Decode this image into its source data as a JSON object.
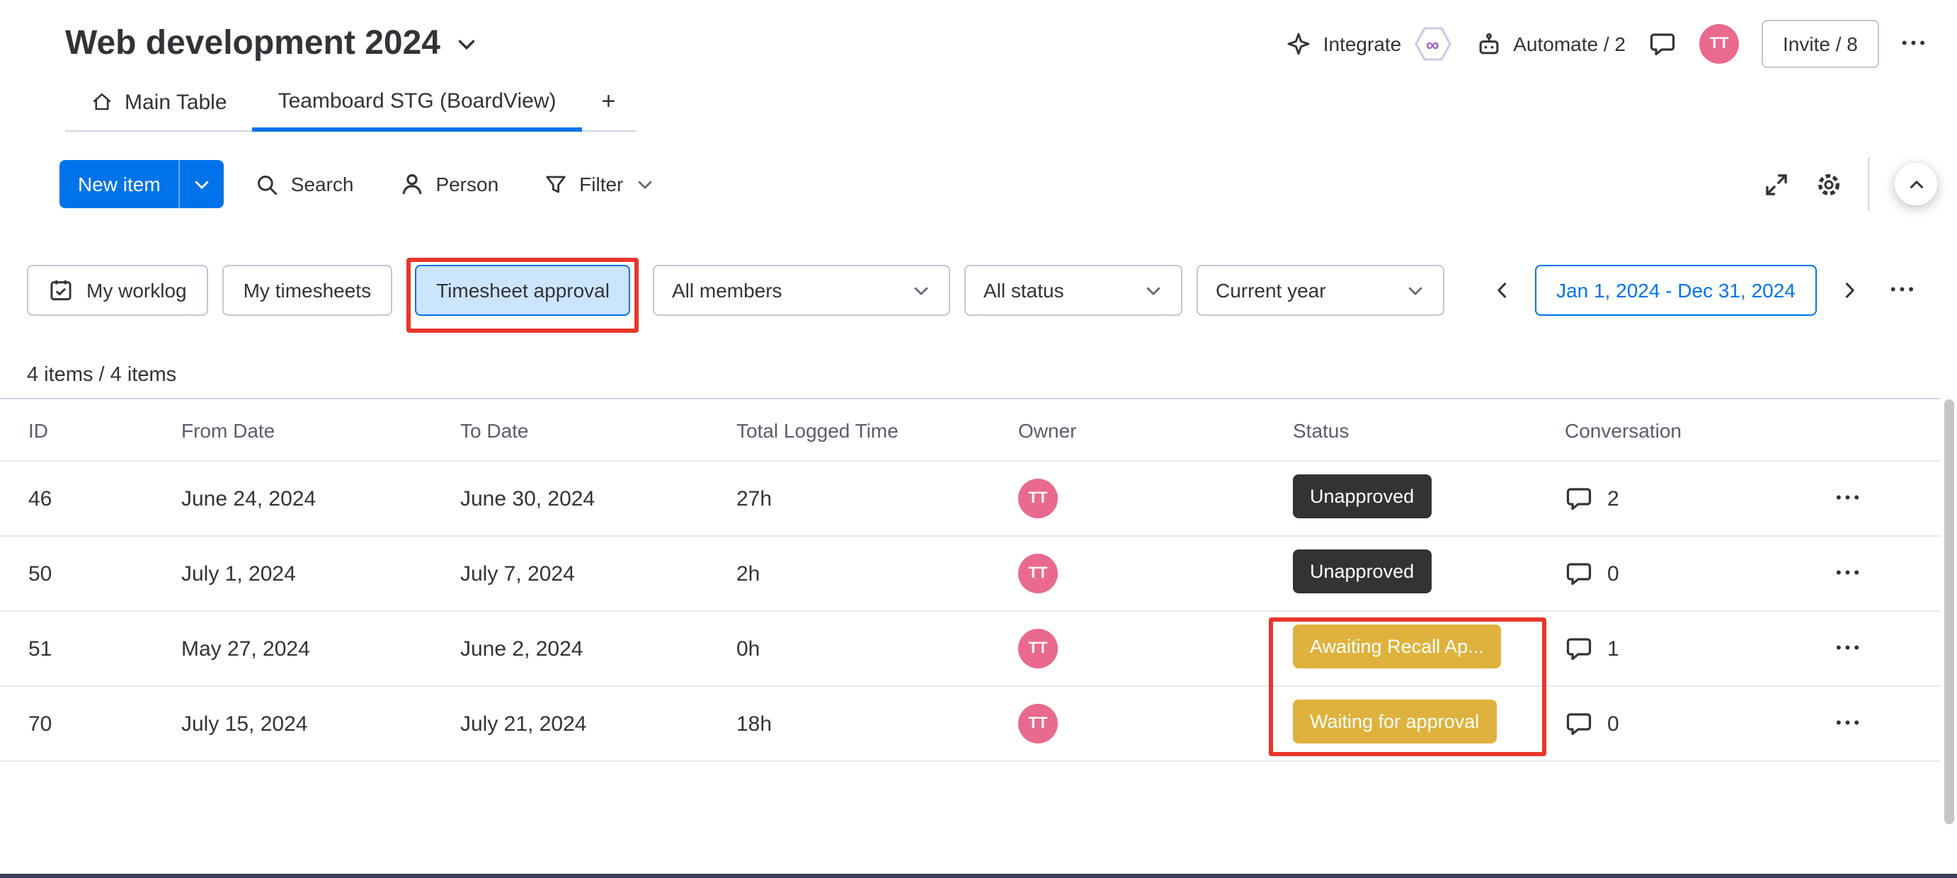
{
  "header": {
    "title": "Web development 2024",
    "integrate": "Integrate",
    "automate": "Automate / 2",
    "invite": "Invite / 8",
    "avatar": "TT"
  },
  "tabs": {
    "main": "Main Table",
    "board": "Teamboard STG (BoardView)",
    "add": "+"
  },
  "toolbar": {
    "new_item": "New item",
    "search": "Search",
    "person": "Person",
    "filter": "Filter"
  },
  "filters": {
    "my_worklog": "My worklog",
    "my_timesheets": "My timesheets",
    "timesheet_approval": "Timesheet approval",
    "members": "All members",
    "status": "All status",
    "period": "Current year",
    "date_range": "Jan 1, 2024 - Dec 31, 2024"
  },
  "summary": "4 items / 4 items",
  "table": {
    "columns": [
      "ID",
      "From Date",
      "To Date",
      "Total Logged Time",
      "Owner",
      "Status",
      "Conversation"
    ],
    "rows": [
      {
        "id": "46",
        "from": "June 24, 2024",
        "to": "June 30, 2024",
        "time": "27h",
        "owner": "TT",
        "status": "Unapproved",
        "status_type": "dark",
        "conversations": "2"
      },
      {
        "id": "50",
        "from": "July 1, 2024",
        "to": "July 7, 2024",
        "time": "2h",
        "owner": "TT",
        "status": "Unapproved",
        "status_type": "dark",
        "conversations": "0"
      },
      {
        "id": "51",
        "from": "May 27, 2024",
        "to": "June 2, 2024",
        "time": "0h",
        "owner": "TT",
        "status": "Awaiting Recall Ap...",
        "status_type": "gold",
        "conversations": "1"
      },
      {
        "id": "70",
        "from": "July 15, 2024",
        "to": "July 21, 2024",
        "time": "18h",
        "owner": "TT",
        "status": "Waiting for approval",
        "status_type": "gold",
        "conversations": "0"
      }
    ]
  },
  "icons": {
    "ellipsis": "•••",
    "infinity": "∞"
  },
  "colors": {
    "accent": "#0073ea",
    "avatar": "#e96a8e",
    "status_dark": "#333333",
    "status_gold": "#deb23c",
    "annotation": "#e8362b"
  }
}
